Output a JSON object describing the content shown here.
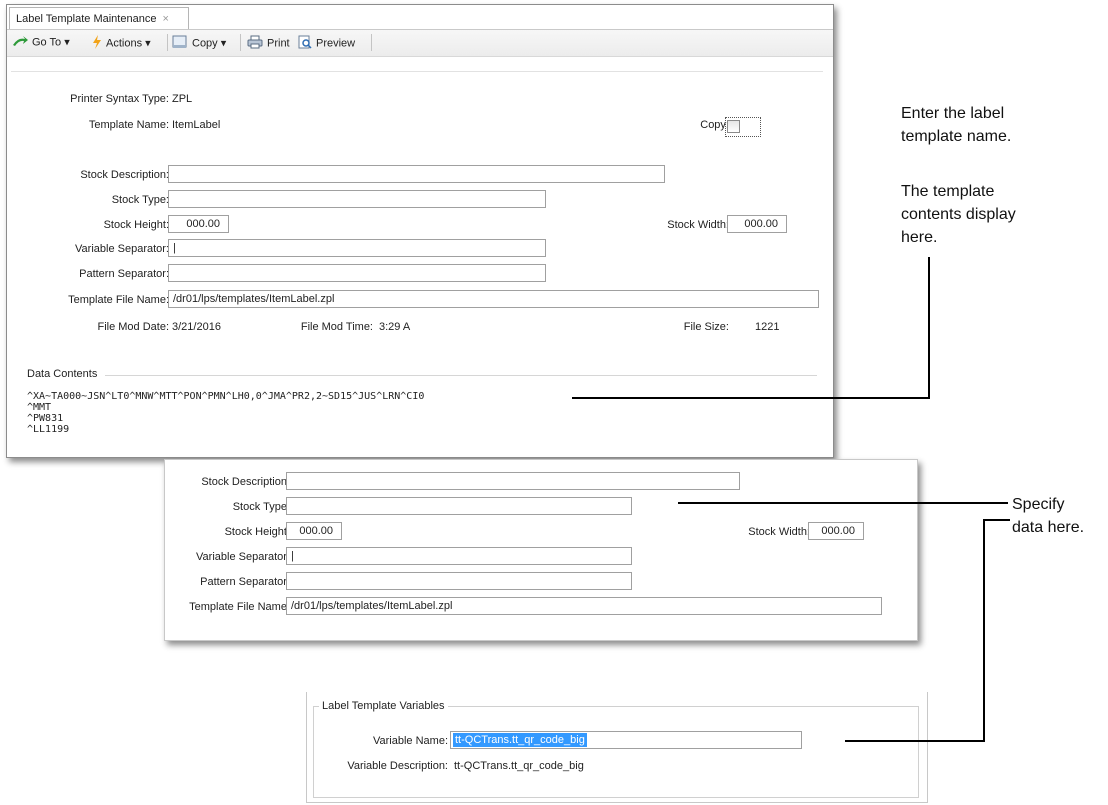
{
  "window": {
    "tab_title": "Label Template Maintenance",
    "tab_close": "×",
    "toolbar": {
      "goto": "Go To",
      "actions": "Actions",
      "copy": "Copy",
      "print": "Print",
      "preview": "Preview",
      "dropdown_glyph": "▾"
    },
    "form": {
      "printer_syntax_label": "Printer Syntax Type:",
      "printer_syntax_value": "ZPL",
      "template_name_label": "Template Name:",
      "template_name_value": "ItemLabel",
      "copy_label": "Copy:",
      "stock_desc_label": "Stock Description:",
      "stock_desc_value": "",
      "stock_type_label": "Stock Type:",
      "stock_type_value": "",
      "stock_height_label": "Stock Height:",
      "stock_height_value": "000.00",
      "stock_width_label": "Stock Width:",
      "stock_width_value": "000.00",
      "var_sep_label": "Variable Separator:",
      "var_sep_value": "|",
      "pattern_sep_label": "Pattern Separator:",
      "pattern_sep_value": "",
      "template_file_label": "Template File Name:",
      "template_file_value": "/dr01/lps/templates/ItemLabel.zpl",
      "file_mod_date_label": "File Mod Date:",
      "file_mod_date_value": "3/21/2016",
      "file_mod_time_label": "File Mod Time:",
      "file_mod_time_value": "3:29 A",
      "file_size_label": "File Size:",
      "file_size_value": "1221",
      "data_contents_label": "Data Contents",
      "data_lines": [
        "^XA~TA000~JSN^LT0^MNW^MTT^PON^PMN^LH0,0^JMA^PR2,2~SD15^JUS^LRN^CI0",
        "^MMT",
        "^PW831",
        "^LL1199"
      ]
    }
  },
  "detail": {
    "stock_desc_label": "Stock Description:",
    "stock_desc_value": "",
    "stock_type_label": "Stock Type:",
    "stock_type_value": "",
    "stock_height_label": "Stock Height:",
    "stock_height_value": "000.00",
    "stock_width_label": "Stock Width:",
    "stock_width_value": "000.00",
    "var_sep_label": "Variable Separator:",
    "var_sep_value": "|",
    "pattern_sep_label": "Pattern Separator:",
    "pattern_sep_value": "",
    "template_file_label": "Template File Name:",
    "template_file_value": "/dr01/lps/templates/ItemLabel.zpl"
  },
  "variables": {
    "group_title": "Label Template Variables",
    "var_name_label": "Variable Name:",
    "var_name_value": "tt-QCTrans.tt_qr_code_big",
    "var_desc_label": "Variable Description:",
    "var_desc_value": "tt-QCTrans.tt_qr_code_big"
  },
  "callouts": {
    "enter_name": [
      "Enter the label",
      "template name."
    ],
    "contents": [
      "The template",
      "contents display",
      "here."
    ],
    "specify": [
      "Specify",
      "data here."
    ]
  },
  "colors": {
    "selection": "#3399ff",
    "border": "#a0a0a0"
  }
}
